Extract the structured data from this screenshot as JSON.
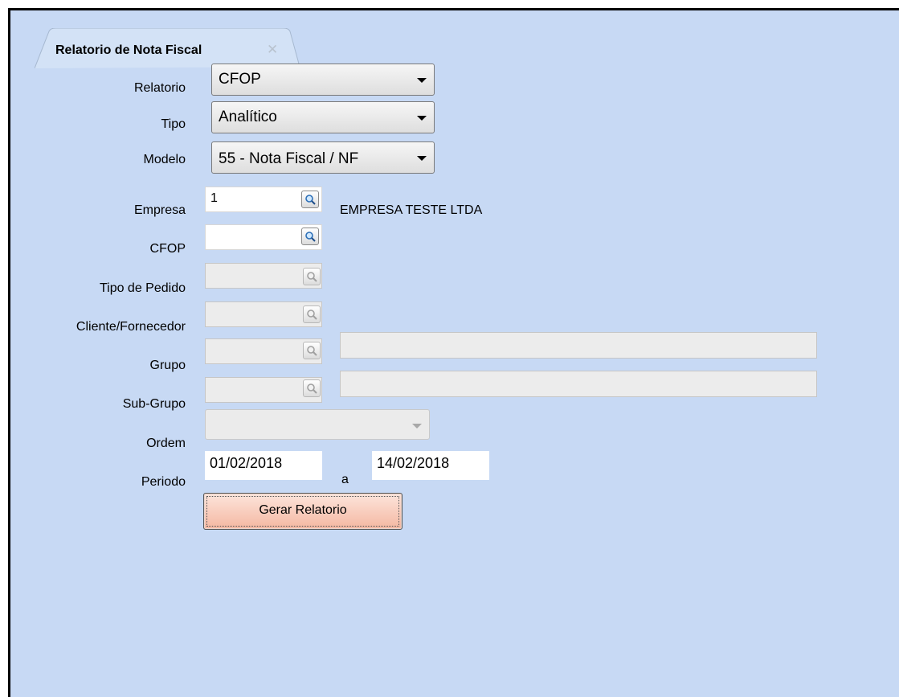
{
  "tab": {
    "title": "Relatorio de Nota Fiscal",
    "close_glyph": "✕"
  },
  "labels": {
    "relatorio": "Relatorio",
    "tipo": "Tipo",
    "modelo": "Modelo",
    "empresa": "Empresa",
    "cfop": "CFOP",
    "tipo_pedido": "Tipo de Pedido",
    "cliente_fornecedor": "Cliente/Fornecedor",
    "grupo": "Grupo",
    "sub_grupo": "Sub-Grupo",
    "ordem": "Ordem",
    "periodo": "Periodo"
  },
  "fields": {
    "relatorio": "CFOP",
    "tipo": "Analítico",
    "modelo": "55 - Nota Fiscal / NF",
    "empresa_code": "1",
    "empresa_name": "EMPRESA TESTE LTDA",
    "cfop": "",
    "tipo_pedido": "",
    "cliente_fornecedor": "",
    "grupo": "",
    "sub_grupo": "",
    "ordem": "",
    "periodo_inicio": "01/02/2018",
    "periodo_sep": "a",
    "periodo_fim": "14/02/2018"
  },
  "buttons": {
    "gerar": "Gerar Relatorio"
  },
  "icons": {
    "lookup": "magnifier-icon",
    "dropdown": "chevron-down-icon",
    "close": "close-icon"
  },
  "colors": {
    "background": "#c7d9f4",
    "button": "#f4b7a1"
  }
}
